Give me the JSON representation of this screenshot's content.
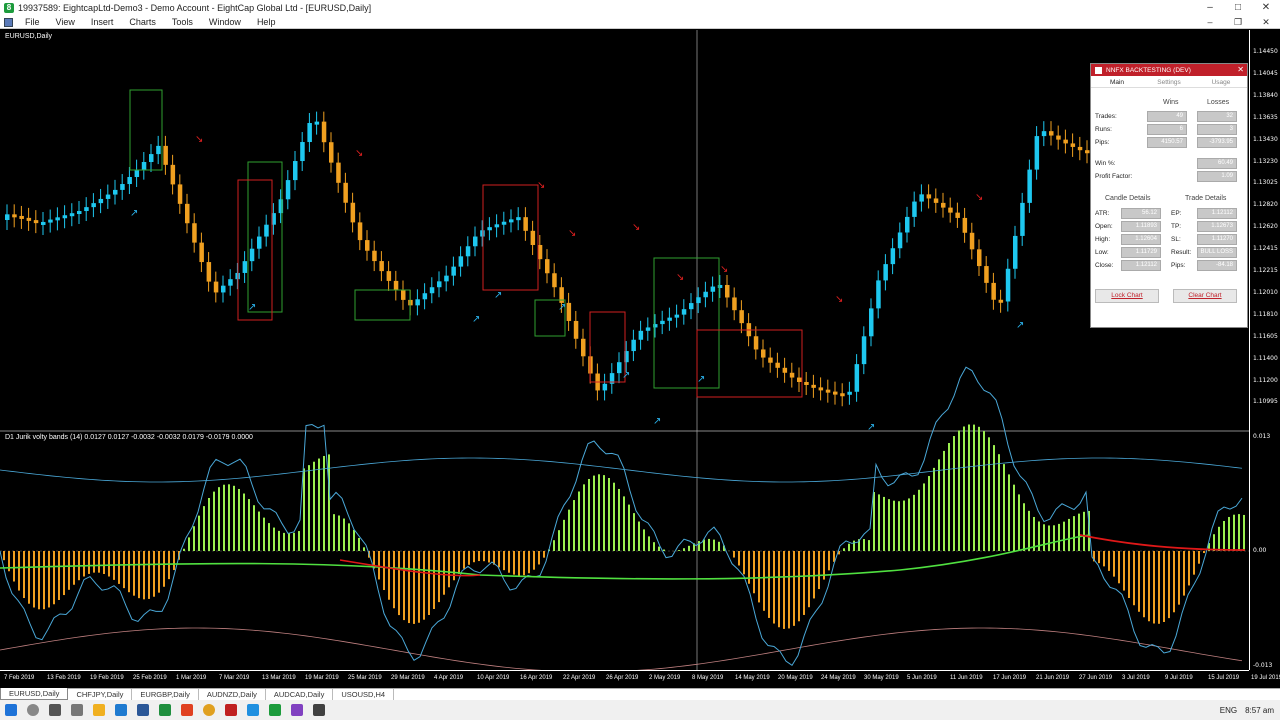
{
  "window": {
    "title": "19937589: EightcapLtd-Demo3 - Demo Account - EightCap Global Ltd - [EURUSD,Daily]",
    "controls": [
      "–",
      "□",
      "✕"
    ]
  },
  "menu": {
    "items": [
      "File",
      "View",
      "Insert",
      "Charts",
      "Tools",
      "Window",
      "Help"
    ],
    "controls": [
      "–",
      "❐",
      "✕"
    ]
  },
  "chart": {
    "symbol_label": "EURUSD,Daily",
    "indicator_label": "D1 Jurik volty bands (14) 0.0127 0.0127 -0.0032 -0.0032 0.0179 -0.0179 0.0000",
    "price_labels": [
      "1.14450",
      "1.14045",
      "1.13840",
      "1.13635",
      "1.13430",
      "1.13230",
      "1.13025",
      "1.12820",
      "1.12620",
      "1.12415",
      "1.12215",
      "1.12010",
      "1.11810",
      "1.11605",
      "1.11400",
      "1.11200",
      "1.10995"
    ],
    "indicator_labels": [
      "0.013",
      "0.00",
      "-0.013"
    ],
    "date_labels": [
      "7 Feb 2019",
      "13 Feb 2019",
      "19 Feb 2019",
      "25 Feb 2019",
      "1 Mar 2019",
      "7 Mar 2019",
      "13 Mar 2019",
      "19 Mar 2019",
      "25 Mar 2019",
      "29 Mar 2019",
      "4 Apr 2019",
      "10 Apr 2019",
      "16 Apr 2019",
      "22 Apr 2019",
      "26 Apr 2019",
      "2 May 2019",
      "8 May 2019",
      "14 May 2019",
      "20 May 2019",
      "24 May 2019",
      "30 May 2019",
      "5 Jun 2019",
      "11 Jun 2019",
      "17 Jun 2019",
      "21 Jun 2019",
      "27 Jun 2019",
      "3 Jul 2019",
      "9 Jul 2019",
      "15 Jul 2019",
      "19 Jul 2019"
    ],
    "colors": {
      "bull": "#1ec8f0",
      "bear": "#f0a020",
      "histo_up": "#9cf050",
      "histo_down": "#f0a020",
      "band": "#4aa8d8",
      "signal_up": "#50e040",
      "signal_down": "#e01818",
      "arrow_up": "#2ab0e8",
      "arrow_down": "#e02020",
      "box_green": "#30a030",
      "box_red": "#d02020"
    }
  },
  "backtest": {
    "title": "NNFX BACKTESTING (DEV)",
    "tabs": [
      "Main",
      "Settings",
      "Usage"
    ],
    "col_wins": "Wins",
    "col_losses": "Losses",
    "rows": [
      {
        "label": "Trades:",
        "wins": "49",
        "losses": "32"
      },
      {
        "label": "Runs:",
        "wins": "6",
        "losses": "3"
      },
      {
        "label": "Pips:",
        "wins": "4150.57",
        "losses": "-3793.95"
      }
    ],
    "win_pct_label": "Win %:",
    "win_pct": "60.49",
    "profit_factor_label": "Profit Factor:",
    "profit_factor": "1.09",
    "candle_title": "Candle Details",
    "trade_title": "Trade Details",
    "candle": [
      {
        "label": "ATR:",
        "value": "56.12"
      },
      {
        "label": "Open:",
        "value": "1.11893"
      },
      {
        "label": "High:",
        "value": "1.12604"
      },
      {
        "label": "Low:",
        "value": "1.11729"
      },
      {
        "label": "Close:",
        "value": "1.12112"
      }
    ],
    "trade": [
      {
        "label": "EP:",
        "value": "1.12112"
      },
      {
        "label": "TP:",
        "value": "1.12673"
      },
      {
        "label": "SL:",
        "value": "1.11270"
      },
      {
        "label": "Result:",
        "value": "BULL LOSS"
      },
      {
        "label": "Pips:",
        "value": "-84.18"
      }
    ],
    "lock_label": "Lock Chart",
    "clear_label": "Clear Chart"
  },
  "symbol_tabs": [
    "EURUSD,Daily",
    "CHFJPY,Daily",
    "EURGBP,Daily",
    "AUDNZD,Daily",
    "AUDCAD,Daily",
    "USOUSD,H4"
  ],
  "taskbar": {
    "lang": "ENG",
    "time": "8:57 am"
  }
}
